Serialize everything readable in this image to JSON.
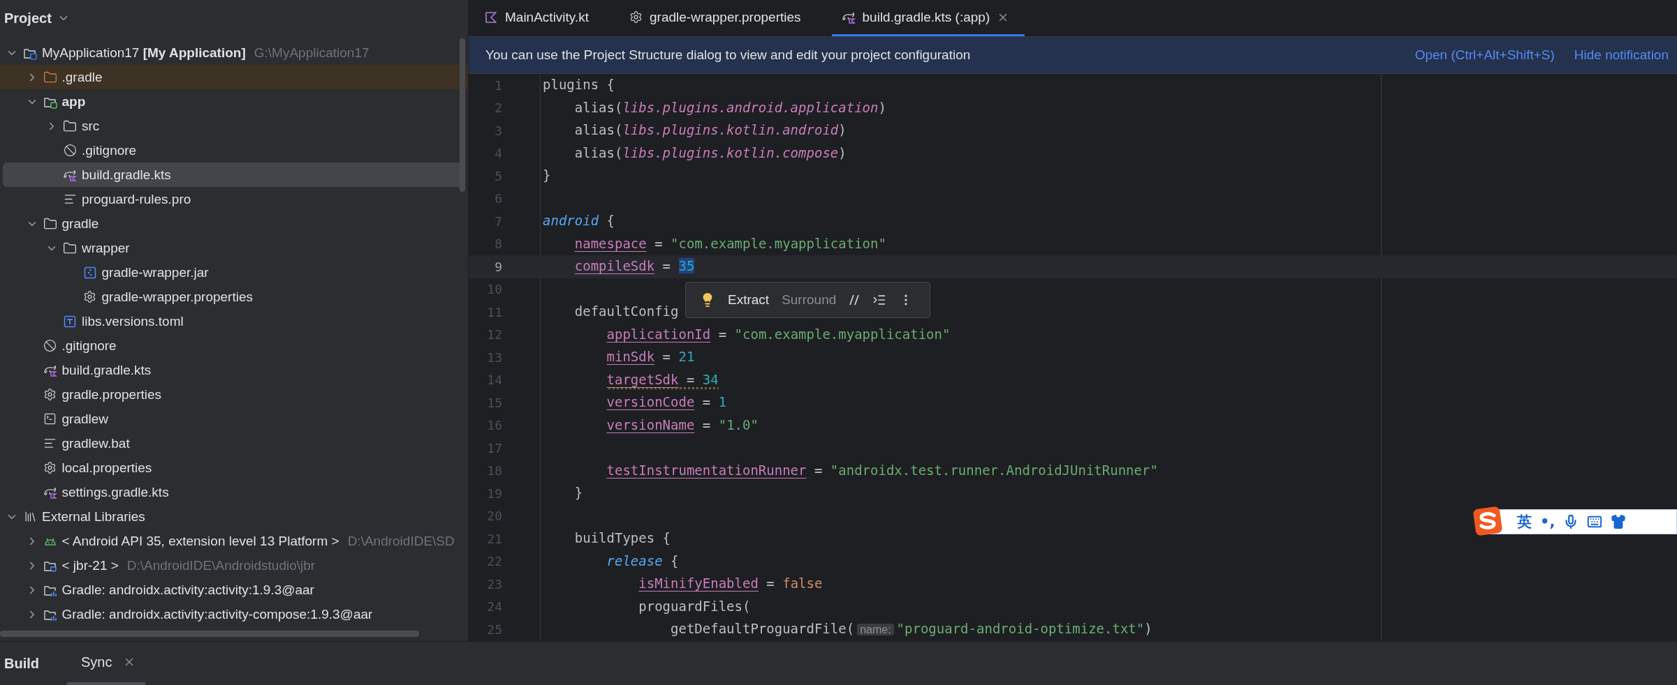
{
  "project_panel": {
    "title": "Project"
  },
  "tree": [
    {
      "label": "MyApplication17 **[My Application]**",
      "note": "G:\\MyApplication17",
      "kind": "project",
      "selected": false,
      "expanded": true,
      "children": [
        {
          "label": ".gradle",
          "kind": "excluded-folder",
          "selected": false,
          "expanded": false
        },
        {
          "label": "app",
          "kind": "module",
          "selected": false,
          "expanded": true,
          "children": [
            {
              "label": "src",
              "kind": "folder",
              "selected": false,
              "expanded": false
            },
            {
              "label": ".gitignore",
              "kind": "ignore",
              "selected": false
            },
            {
              "label": "build.gradle.kts",
              "kind": "gradle-kts",
              "selected": true
            },
            {
              "label": "proguard-rules.pro",
              "kind": "text",
              "selected": false
            }
          ]
        },
        {
          "label": "gradle",
          "kind": "folder",
          "selected": false,
          "expanded": true,
          "children": [
            {
              "label": "wrapper",
              "kind": "folder",
              "selected": false,
              "expanded": true,
              "children": [
                {
                  "label": "gradle-wrapper.jar",
                  "kind": "jar",
                  "selected": false
                },
                {
                  "label": "gradle-wrapper.properties",
                  "kind": "properties",
                  "selected": false
                }
              ]
            },
            {
              "label": "libs.versions.toml",
              "kind": "toml",
              "selected": false
            }
          ]
        },
        {
          "label": ".gitignore",
          "kind": "ignore",
          "selected": false
        },
        {
          "label": "build.gradle.kts",
          "kind": "gradle-kts",
          "selected": false
        },
        {
          "label": "gradle.properties",
          "kind": "properties",
          "selected": false
        },
        {
          "label": "gradlew",
          "kind": "terminal",
          "selected": false
        },
        {
          "label": "gradlew.bat",
          "kind": "text",
          "selected": false
        },
        {
          "label": "local.properties",
          "kind": "properties",
          "selected": false
        },
        {
          "label": "settings.gradle.kts",
          "kind": "gradle-kts",
          "selected": false
        }
      ]
    },
    {
      "label": "External Libraries",
      "kind": "libraries",
      "selected": false,
      "expanded": true,
      "children": [
        {
          "label": "< Android API 35, extension level 13 Platform >",
          "note": "D:\\AndroidIDE\\SD",
          "kind": "android",
          "selected": false,
          "expanded": false
        },
        {
          "label": "< jbr-21 >",
          "note": "D:\\AndroidIDE\\Androidstudio\\jbr",
          "kind": "jdk",
          "selected": false,
          "expanded": false
        },
        {
          "label": "Gradle: androidx.activity:activity:1.9.3@aar",
          "kind": "library",
          "selected": false,
          "expanded": false
        },
        {
          "label": "Gradle: androidx.activity:activity-compose:1.9.3@aar",
          "kind": "library",
          "selected": false,
          "expanded": false
        }
      ]
    }
  ],
  "editor_tabs": [
    {
      "label": "MainActivity.kt",
      "kind": "kotlin",
      "selected": false,
      "closable": false
    },
    {
      "label": "gradle-wrapper.properties",
      "kind": "properties",
      "selected": false,
      "closable": false
    },
    {
      "label": "build.gradle.kts (:app)",
      "kind": "gradle-kts",
      "selected": true,
      "closable": true
    }
  ],
  "notification": {
    "message": "You can use the Project Structure dialog to view and edit your project configuration",
    "actions": [
      "Open (Ctrl+Alt+Shift+S)",
      "Hide notification"
    ]
  },
  "code_lines": [
    {
      "number": "1",
      "current": false,
      "warning": false,
      "tokens": [
        {
          "kind": "plain",
          "text": "plugins {"
        }
      ]
    },
    {
      "number": "2",
      "current": false,
      "warning": false,
      "tokens": [
        {
          "kind": "plain",
          "text": "    alias("
        },
        {
          "kind": "ref",
          "text": "libs.plugins.android.application"
        },
        {
          "kind": "plain",
          "text": ")"
        }
      ]
    },
    {
      "number": "3",
      "current": false,
      "warning": false,
      "tokens": [
        {
          "kind": "plain",
          "text": "    alias("
        },
        {
          "kind": "ref",
          "text": "libs.plugins.kotlin.android"
        },
        {
          "kind": "plain",
          "text": ")"
        }
      ]
    },
    {
      "number": "4",
      "current": false,
      "warning": false,
      "tokens": [
        {
          "kind": "plain",
          "text": "    alias("
        },
        {
          "kind": "ref",
          "text": "libs.plugins.kotlin.compose"
        },
        {
          "kind": "plain",
          "text": ")"
        }
      ]
    },
    {
      "number": "5",
      "current": false,
      "warning": false,
      "tokens": [
        {
          "kind": "plain",
          "text": "}"
        }
      ]
    },
    {
      "number": "6",
      "current": false,
      "warning": false
    },
    {
      "number": "7",
      "current": false,
      "warning": false,
      "tokens": [
        {
          "kind": "keyword",
          "text": "android"
        },
        {
          "kind": "plain",
          "text": " {"
        }
      ]
    },
    {
      "number": "8",
      "current": false,
      "warning": false,
      "tokens": [
        {
          "kind": "prop",
          "text": "    namespace"
        },
        {
          "kind": "plain",
          "text": " = "
        },
        {
          "kind": "string",
          "text": "\"com.example.myapplication\""
        }
      ]
    },
    {
      "number": "9",
      "current": true,
      "warning": false,
      "tokens": [
        {
          "kind": "prop",
          "text": "    compileSdk"
        },
        {
          "kind": "plain",
          "text": " = "
        },
        {
          "kind": "selection",
          "text": "35"
        }
      ]
    },
    {
      "number": "10",
      "current": false,
      "warning": false
    },
    {
      "number": "11",
      "current": false,
      "warning": false,
      "tokens": [
        {
          "kind": "plain",
          "text": "    defaultConfig"
        }
      ]
    },
    {
      "number": "12",
      "current": false,
      "warning": false,
      "tokens": [
        {
          "kind": "prop",
          "text": "        applicationId"
        },
        {
          "kind": "plain",
          "text": " = "
        },
        {
          "kind": "string",
          "text": "\"com.example.myapplication\""
        }
      ]
    },
    {
      "number": "13",
      "current": false,
      "warning": false,
      "tokens": [
        {
          "kind": "prop",
          "text": "        minSdk"
        },
        {
          "kind": "plain",
          "text": " = "
        },
        {
          "kind": "number",
          "text": "21"
        }
      ]
    },
    {
      "number": "14",
      "current": false,
      "warning": true,
      "tokens": [
        {
          "kind": "prop",
          "text": "        targetSdk"
        },
        {
          "kind": "plain",
          "text": " = "
        },
        {
          "kind": "number",
          "text": "34"
        }
      ]
    },
    {
      "number": "15",
      "current": false,
      "warning": false,
      "tokens": [
        {
          "kind": "prop",
          "text": "        versionCode"
        },
        {
          "kind": "plain",
          "text": " = "
        },
        {
          "kind": "number",
          "text": "1"
        }
      ]
    },
    {
      "number": "16",
      "current": false,
      "warning": false,
      "tokens": [
        {
          "kind": "prop",
          "text": "        versionName"
        },
        {
          "kind": "plain",
          "text": " = "
        },
        {
          "kind": "string",
          "text": "\"1.0\""
        }
      ]
    },
    {
      "number": "17",
      "current": false,
      "warning": false
    },
    {
      "number": "18",
      "current": false,
      "warning": false,
      "tokens": [
        {
          "kind": "prop",
          "text": "        testInstrumentationRunner"
        },
        {
          "kind": "plain",
          "text": " = "
        },
        {
          "kind": "string",
          "text": "\"androidx.test.runner.AndroidJUnitRunner\""
        }
      ]
    },
    {
      "number": "19",
      "current": false,
      "warning": false,
      "tokens": [
        {
          "kind": "plain",
          "text": "    }"
        }
      ]
    },
    {
      "number": "20",
      "current": false,
      "warning": false
    },
    {
      "number": "21",
      "current": false,
      "warning": false,
      "tokens": [
        {
          "kind": "plain",
          "text": "    buildTypes {"
        }
      ]
    },
    {
      "number": "22",
      "current": false,
      "warning": false,
      "tokens": [
        {
          "kind": "keyword",
          "text": "        release"
        },
        {
          "kind": "plain",
          "text": " {"
        }
      ]
    },
    {
      "number": "23",
      "current": false,
      "warning": false,
      "tokens": [
        {
          "kind": "prop",
          "text": "            isMinifyEnabled"
        },
        {
          "kind": "plain",
          "text": " = "
        },
        {
          "kind": "bool",
          "text": "false"
        }
      ]
    },
    {
      "number": "24",
      "current": false,
      "warning": false,
      "tokens": [
        {
          "kind": "plain",
          "text": "            proguardFiles("
        }
      ]
    },
    {
      "number": "25",
      "current": false,
      "warning": false,
      "tokens": [
        {
          "kind": "plain",
          "text": "                getDefaultProguardFile("
        },
        {
          "kind": "hint",
          "text": "name:"
        },
        {
          "kind": "string",
          "text": "\"proguard-android-optimize.txt\""
        },
        {
          "kind": "plain",
          "text": ")"
        }
      ]
    }
  ],
  "popup": {
    "actions": [
      {
        "label": "Extract",
        "enabled": true
      },
      {
        "label": "Surround",
        "enabled": false
      }
    ]
  },
  "bottom_bar": {
    "title": "Build",
    "tabs": [
      {
        "label": "Sync",
        "selected": true,
        "closable": true
      }
    ]
  },
  "ime_toolbar": {
    "mode": "英",
    "punctuation": "•,"
  }
}
